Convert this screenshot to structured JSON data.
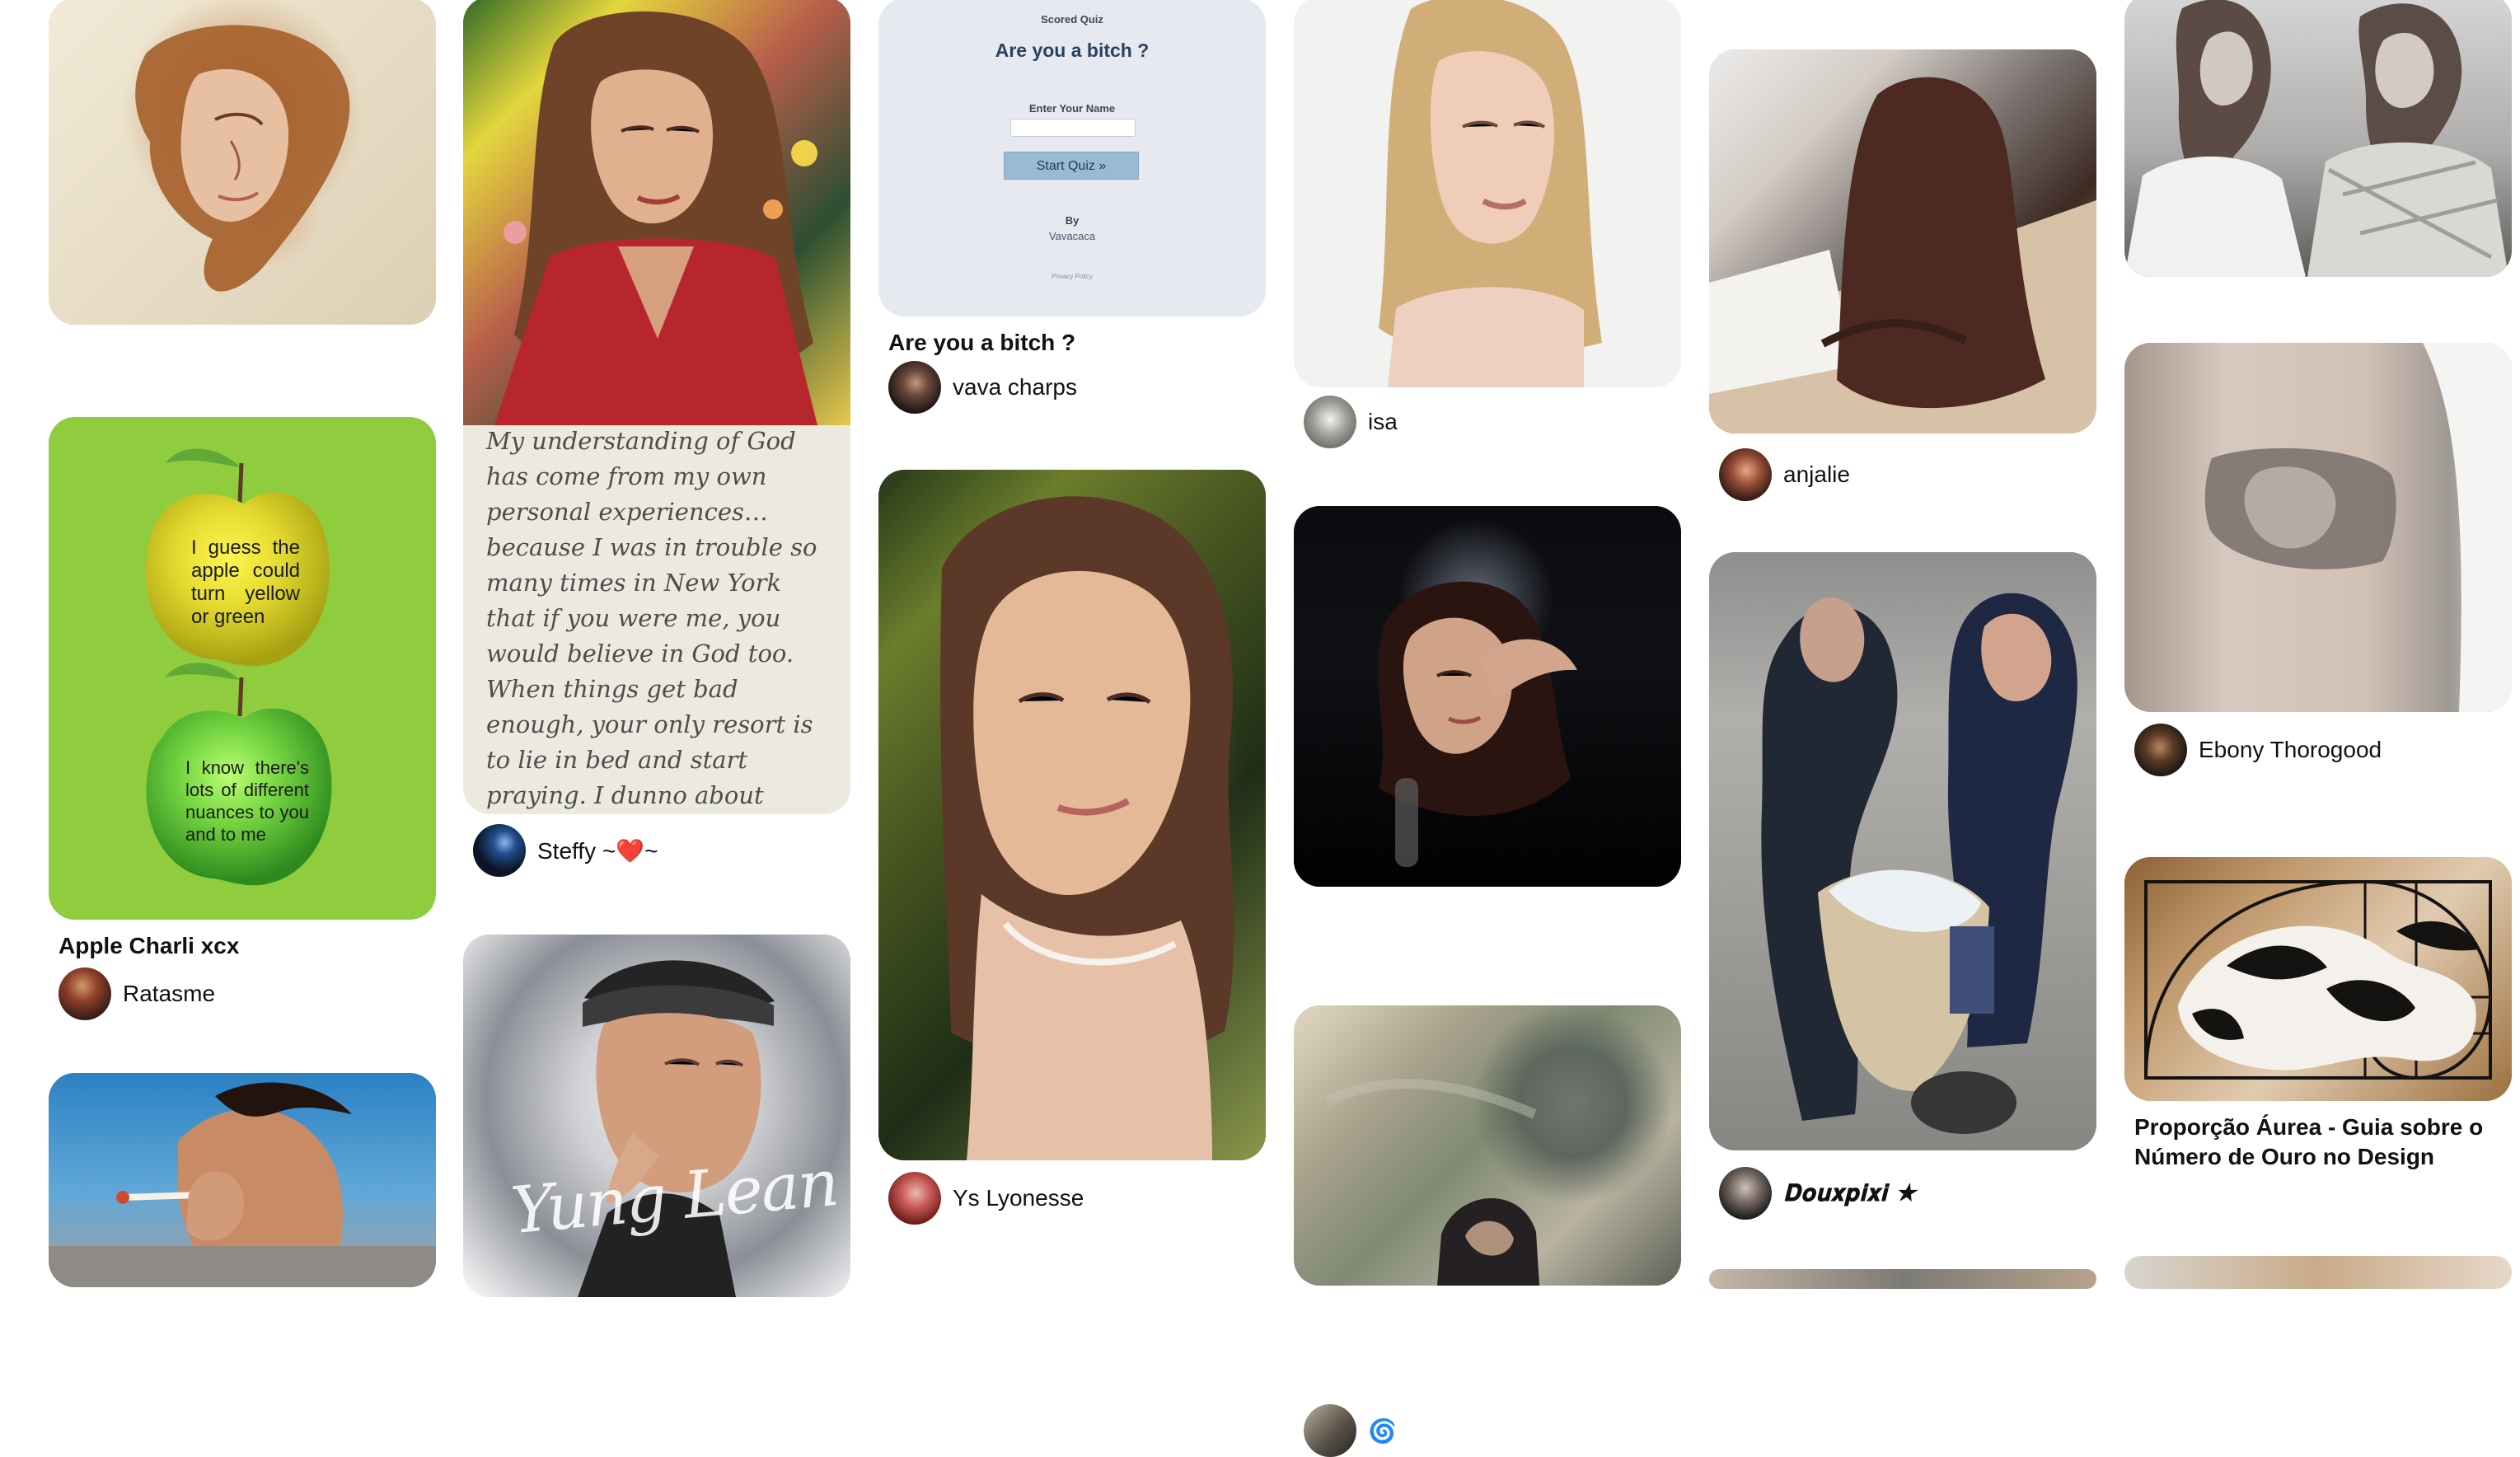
{
  "colors": {
    "title_text": "#111111",
    "author_text": "#111111",
    "apple_background": "#8fcc3e",
    "quiz_background": "#e6eaf0",
    "quiz_button": "#9ab9d5"
  },
  "pins": [
    {
      "id": "pin-1",
      "image": "painting-woman-red-hair"
    },
    {
      "id": "pin-2",
      "image": "apple-charli-xcx",
      "title": "Apple Charli xcx",
      "author": "Ratasme",
      "apple_top_text": "I guess the apple could turn yellow or green",
      "apple_bottom_text": "I know there's lots of different nuances to you and to me"
    },
    {
      "id": "pin-3",
      "image": "smoking-man"
    },
    {
      "id": "pin-4",
      "image": "woman-red-blouse-with-quote",
      "quote": "My understanding of God has come from my own personal experiences… because I was in trouble so many times in New York that if you were me, you would believe in God too. When things get bad enough, your only resort is to lie in bed and start praying. I dunno about congregating once a week in a church and all that, but when I",
      "author": "Steffy ~❤️~"
    },
    {
      "id": "pin-5",
      "image": "yung-lean",
      "overlay_text": "Yung Lean"
    },
    {
      "id": "pin-6",
      "image": "scored-quiz",
      "quiz": {
        "kicker": "Scored Quiz",
        "title": "Are you a bitch ?",
        "name_label": "Enter Your Name",
        "button": "Start Quiz »",
        "by_label": "By",
        "by_name": "Vavacaca",
        "privacy": "Privacy Policy"
      },
      "title": "Are you a bitch ?",
      "author": "vava charps"
    },
    {
      "id": "pin-7",
      "image": "smiling-girl-portrait",
      "author": "Ys Lyonesse"
    },
    {
      "id": "pin-8",
      "image": "blonde-woman-portrait",
      "author": "isa"
    },
    {
      "id": "pin-9",
      "image": "woman-in-crowd",
      "author": "🌀"
    },
    {
      "id": "pin-10",
      "image": "painting-by-lake"
    },
    {
      "id": "pin-11",
      "image": "woman-writing-at-desk",
      "author": "anjalie"
    },
    {
      "id": "pin-12",
      "image": "couple-with-bassinet",
      "author": "𝐃𝐨𝐮𝐱𝐩𝐢𝐱𝐢 ★"
    },
    {
      "id": "pin-13",
      "image": "partial-image-bottom"
    },
    {
      "id": "pin-14",
      "image": "two-models-black-and-white"
    },
    {
      "id": "pin-15",
      "image": "arm-tattoo-portrait",
      "author": "Ebony Thorogood"
    },
    {
      "id": "pin-16",
      "image": "golden-ratio-dog",
      "title": "Proporção Áurea - Guia sobre o Número de Ouro no Design"
    },
    {
      "id": "pin-17",
      "image": "partial-image-bottom-right"
    }
  ]
}
